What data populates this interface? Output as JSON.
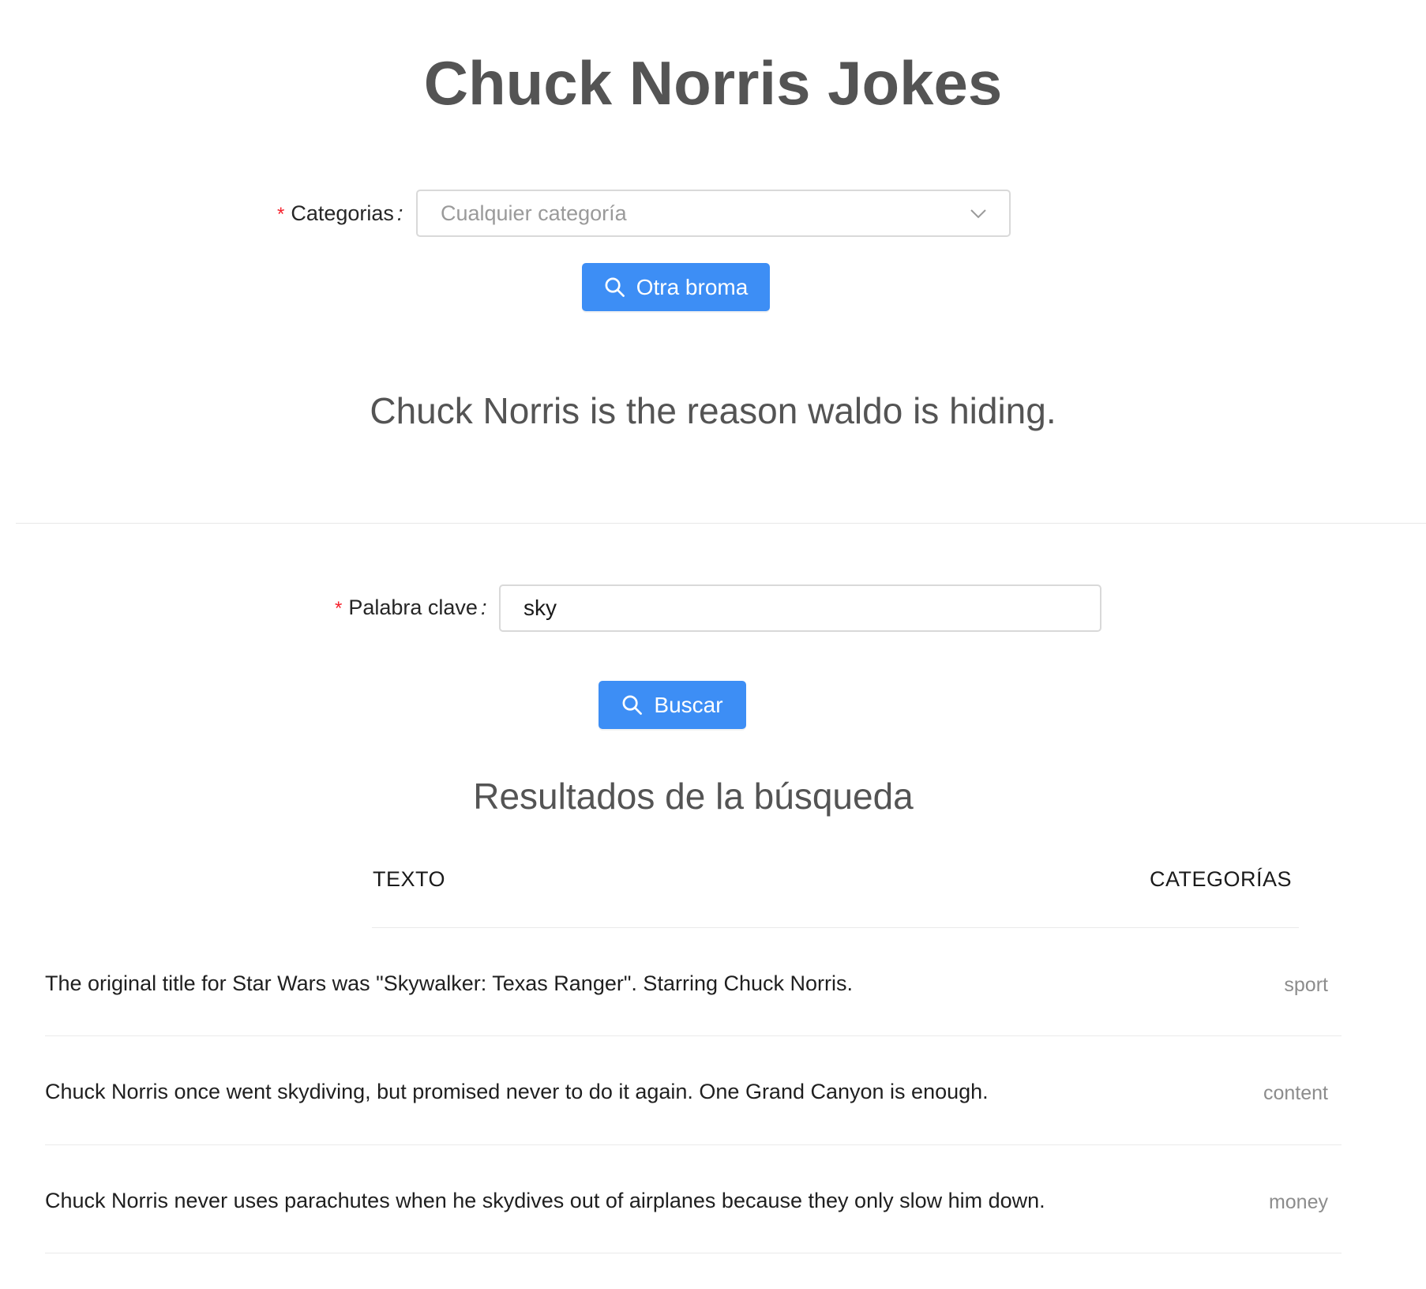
{
  "header": {
    "title": "Chuck Norris Jokes"
  },
  "random_form": {
    "required_mark": "*",
    "label": "Categorias",
    "colon": ":",
    "select_placeholder": "Cualquier categoría",
    "button_label": "Otra broma",
    "button_icon": "search-icon"
  },
  "current_joke": {
    "text": "Chuck Norris is the reason waldo is hiding."
  },
  "search_form": {
    "required_mark": "*",
    "label": "Palabra clave",
    "colon": ":",
    "input_value": "sky",
    "button_label": "Buscar",
    "button_icon": "search-icon"
  },
  "results": {
    "title": "Resultados de la búsqueda",
    "columns": [
      "TEXTO",
      "CATEGORÍAS"
    ],
    "rows": [
      {
        "text": "The original title for Star Wars was \"Skywalker: Texas Ranger\". Starring Chuck Norris.",
        "category": "sport"
      },
      {
        "text": "Chuck Norris once went skydiving, but promised never to do it again. One Grand Canyon is enough.",
        "category": "content"
      },
      {
        "text": "Chuck Norris never uses parachutes when he skydives out of airplanes because they only slow him down.",
        "category": "money"
      }
    ]
  },
  "colors": {
    "primary": "#3d8ef5",
    "required": "#f5222d",
    "heading": "#545454",
    "border": "#d9d9d9"
  }
}
